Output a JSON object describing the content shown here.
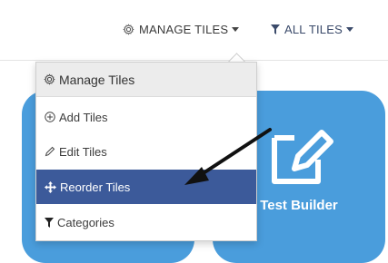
{
  "toolbar": {
    "manage_tiles": "MANAGE TILES",
    "all_tiles": "ALL TILES"
  },
  "menu": {
    "header": "Manage Tiles",
    "items": [
      {
        "label": "Add Tiles",
        "icon": "plus-circle-icon"
      },
      {
        "label": "Edit Tiles",
        "icon": "pencil-icon"
      },
      {
        "label": "Reorder Tiles",
        "icon": "move-arrows-icon",
        "selected": true
      },
      {
        "label": "Categories",
        "icon": "filter-icon"
      }
    ]
  },
  "tiles": [
    {
      "label": ""
    },
    {
      "label": "Test Builder",
      "icon": "edit-square-icon"
    }
  ],
  "colors": {
    "tile": "#4a9ddc",
    "selected": "#3c5a9a",
    "menu_header_bg": "#ececec"
  }
}
